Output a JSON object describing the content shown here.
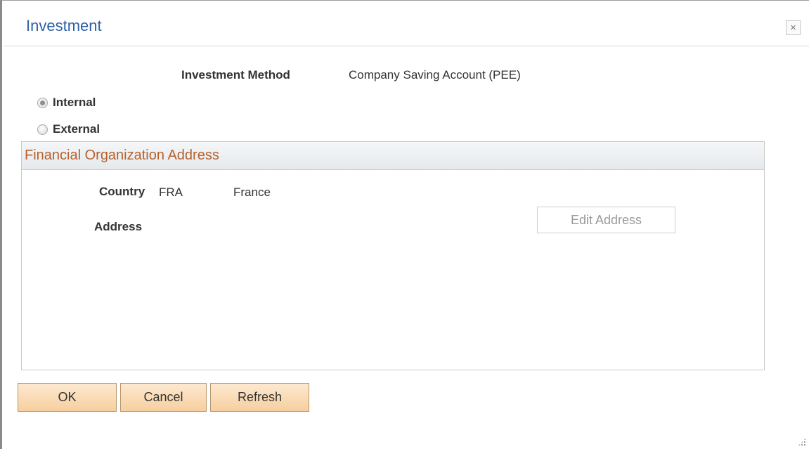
{
  "dialog": {
    "title": "Investment",
    "close_label": "×"
  },
  "investment_method": {
    "label": "Investment Method",
    "value": "Company Saving Account (PEE)"
  },
  "location_options": [
    {
      "label": "Internal",
      "selected": true
    },
    {
      "label": "External",
      "selected": false
    }
  ],
  "financial_org_address": {
    "title": "Financial Organization Address",
    "country_label": "Country",
    "country_code": "FRA",
    "country_name": "France",
    "address_label": "Address",
    "edit_address_label": "Edit Address"
  },
  "buttons": {
    "ok": "OK",
    "cancel": "Cancel",
    "refresh": "Refresh"
  },
  "colors": {
    "title": "#2f60a6",
    "group_title": "#b8612c",
    "button_fill": "#f6cf9f"
  }
}
